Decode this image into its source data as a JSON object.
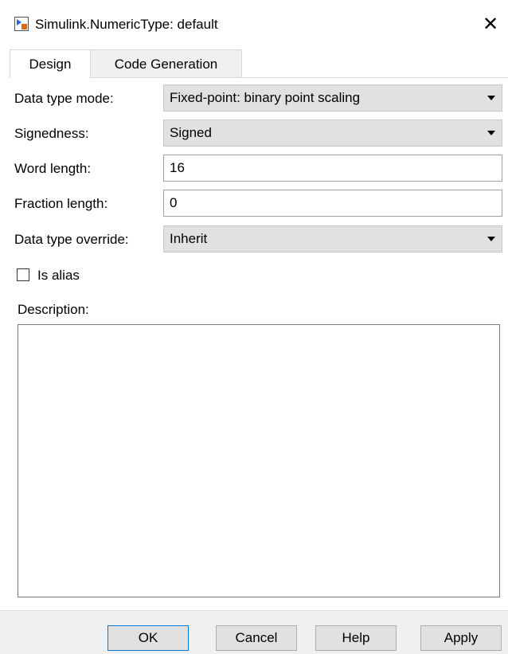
{
  "window": {
    "title": "Simulink.NumericType: default",
    "close_glyph": "✕",
    "icon": "simulink-icon"
  },
  "tabs": [
    {
      "label": "Design",
      "active": true
    },
    {
      "label": "Code Generation",
      "active": false
    }
  ],
  "form": {
    "data_type_mode": {
      "label": "Data type mode:",
      "value": "Fixed-point: binary point scaling"
    },
    "signedness": {
      "label": "Signedness:",
      "value": "Signed"
    },
    "word_length": {
      "label": "Word length:",
      "value": "16"
    },
    "fraction_length": {
      "label": "Fraction length:",
      "value": "0"
    },
    "data_type_override": {
      "label": "Data type override:",
      "value": "Inherit"
    },
    "is_alias": {
      "label": "Is alias",
      "checked": false
    },
    "description": {
      "label": "Description:",
      "value": ""
    }
  },
  "buttons": {
    "ok": "OK",
    "cancel": "Cancel",
    "help": "Help",
    "apply": "Apply"
  },
  "colors": {
    "accent_border": "#0078d7",
    "combo_bg": "#e1e1e1",
    "footer_bg": "#f0f0f0"
  }
}
